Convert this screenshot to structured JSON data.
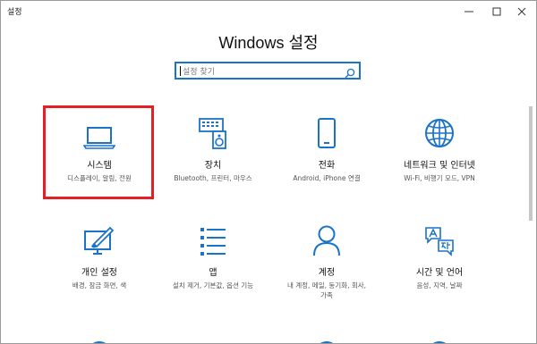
{
  "window": {
    "title": "설정"
  },
  "heading": "Windows 설정",
  "search": {
    "placeholder": "설정 찾기"
  },
  "tiles": [
    {
      "name": "시스템",
      "desc": "디스플레이, 알림, 전원",
      "icon": "laptop-icon"
    },
    {
      "name": "장치",
      "desc": "Bluetooth, 프린터, 마우스",
      "icon": "devices-icon"
    },
    {
      "name": "전화",
      "desc": "Android, iPhone 연결",
      "icon": "phone-icon"
    },
    {
      "name": "네트워크 및 인터넷",
      "desc": "Wi-Fi, 비행기 모드, VPN",
      "icon": "globe-icon"
    },
    {
      "name": "개인 설정",
      "desc": "배경, 잠금 화면, 색",
      "icon": "personalization-icon"
    },
    {
      "name": "앱",
      "desc": "설치 제거, 기본값, 옵션 기능",
      "icon": "apps-list-icon"
    },
    {
      "name": "계정",
      "desc1": "내 계정, 메일, 동기화, 회사,",
      "desc2": "가족",
      "icon": "person-icon"
    },
    {
      "name": "시간 및 언어",
      "desc": "음성, 지역, 날짜",
      "icon": "time-language-icon"
    }
  ],
  "colors": {
    "accent": "#1a73c8",
    "highlight": "#e41f26"
  }
}
